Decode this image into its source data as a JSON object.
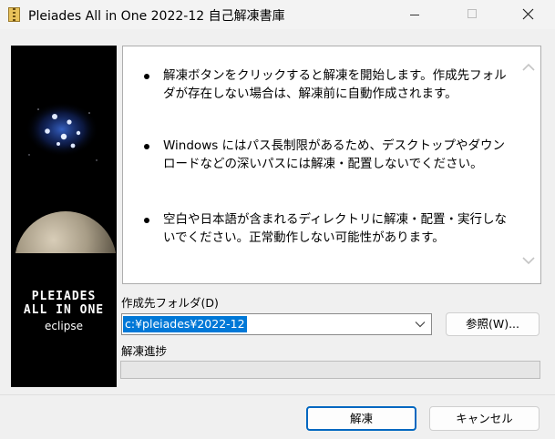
{
  "window": {
    "title": "Pleiades All in One 2022-12 自己解凍書庫",
    "icons": {
      "app": "zip-archive-icon",
      "minimize": "minimize-icon",
      "maximize": "maximize-icon",
      "close": "close-icon"
    }
  },
  "banner": {
    "title_line1": "PLEIADES",
    "title_line2": "ALL IN ONE",
    "subtitle": "eclipse"
  },
  "info": {
    "items": [
      "解凍ボタンをクリックすると解凍を開始します。作成先フォルダが存在しない場合は、解凍前に自動作成されます。",
      "Windows にはパス長制限があるため、デスクトップやダウンロードなどの深いパスには解凍・配置しないでください。",
      "空白や日本語が含まれるディレクトリに解凍・配置・実行しないでください。正常動作しない可能性があります。"
    ]
  },
  "form": {
    "folder_label": "作成先フォルダ(D)",
    "folder_value": "c:¥pleiades¥2022-12",
    "browse_label": "参照(W)...",
    "progress_label": "解凍進捗",
    "progress_percent": 0
  },
  "footer": {
    "extract_label": "解凍",
    "cancel_label": "キャンセル"
  }
}
